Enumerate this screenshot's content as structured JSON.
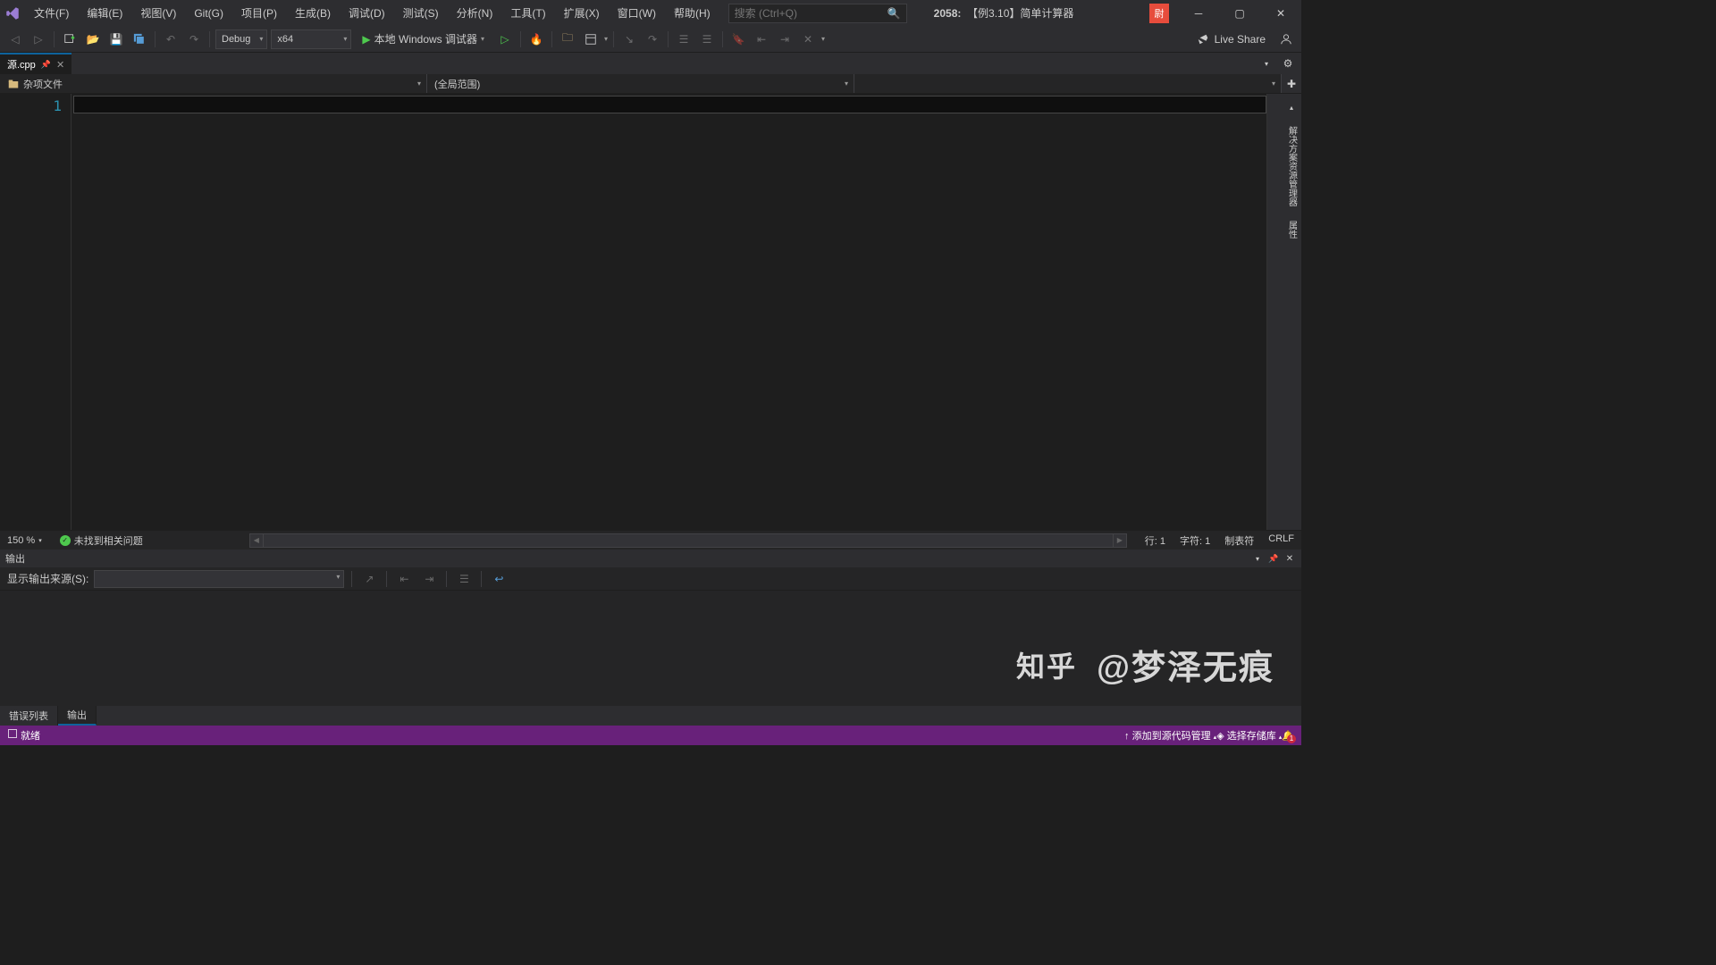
{
  "menu": [
    "文件(F)",
    "编辑(E)",
    "视图(V)",
    "Git(G)",
    "项目(P)",
    "生成(B)",
    "调试(D)",
    "测试(S)",
    "分析(N)",
    "工具(T)",
    "扩展(X)",
    "窗口(W)",
    "帮助(H)"
  ],
  "search": {
    "placeholder": "搜索 (Ctrl+Q)"
  },
  "title": {
    "number": "2058:",
    "text": "【例3.10】简单计算器"
  },
  "user_badge": "尉",
  "toolbar": {
    "config": "Debug",
    "platform": "x64",
    "debug_label": "本地 Windows 调试器",
    "live_share": "Live Share"
  },
  "tab": {
    "name": "源.cpp"
  },
  "nav": {
    "left": "杂项文件",
    "middle": "(全局范围)"
  },
  "editor": {
    "line1": "1"
  },
  "editor_status": {
    "zoom": "150 %",
    "issues": "未找到相关问题",
    "line": "行: 1",
    "char": "字符: 1",
    "tabs": "制表符",
    "crlf": "CRLF"
  },
  "output": {
    "title": "输出",
    "source_label": "显示输出来源(S):"
  },
  "panel_tabs": [
    "错误列表",
    "输出"
  ],
  "statusbar": {
    "ready": "就绪",
    "add_source": "添加到源代码管理",
    "select_repo": "选择存储库"
  },
  "watermark": {
    "brand": "知乎",
    "text": "@梦泽无痕"
  },
  "right_tabs": [
    "解决方案资源管理器",
    "属性"
  ]
}
